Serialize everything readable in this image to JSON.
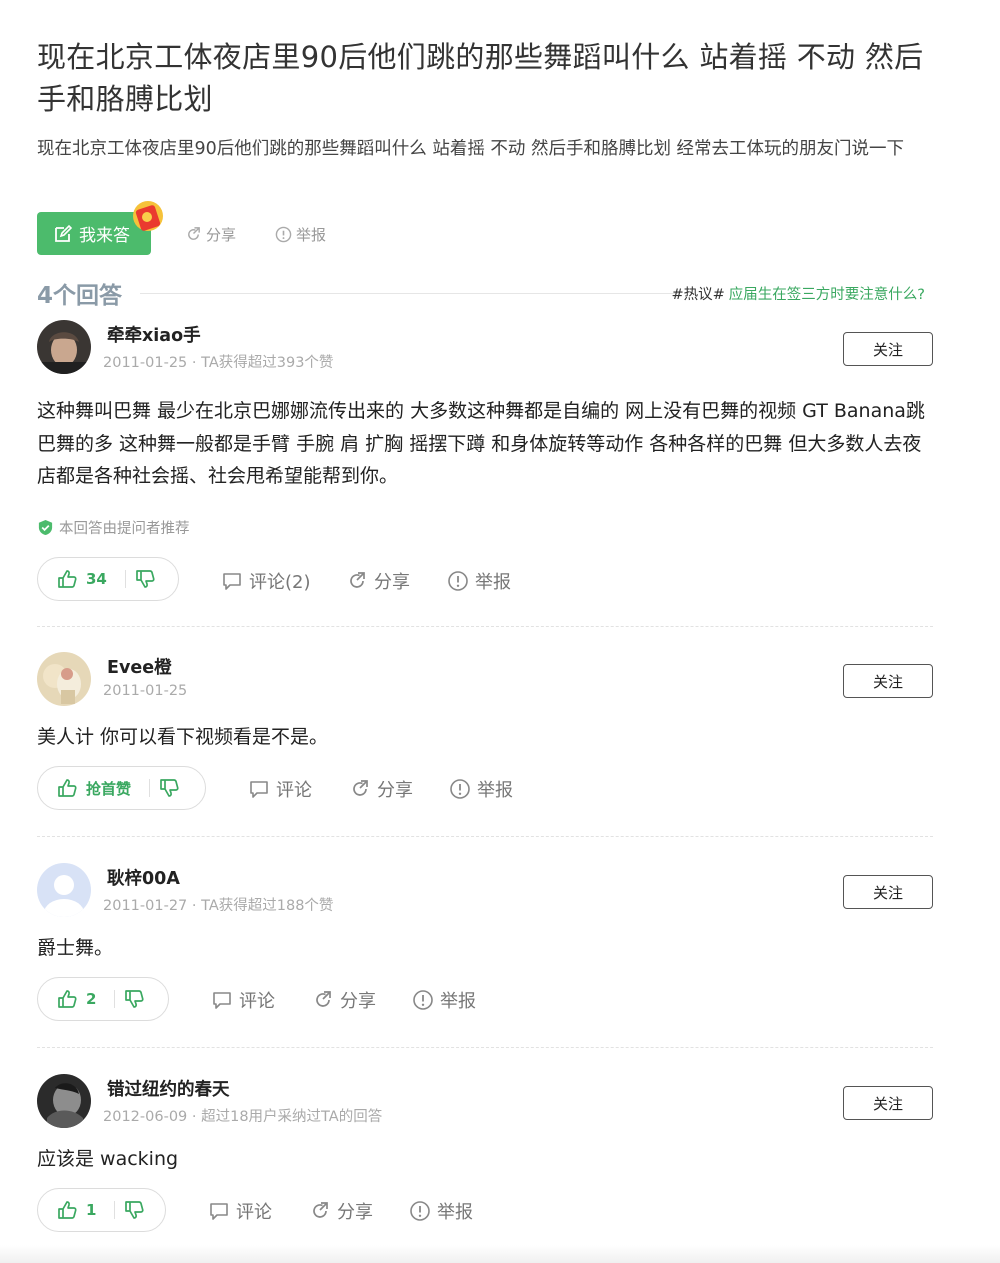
{
  "question": {
    "title": "现在北京工体夜店里90后他们跳的那些舞蹈叫什么 站着摇 不动 然后手和胳膊比划",
    "description": "现在北京工体夜店里90后他们跳的那些舞蹈叫什么 站着摇 不动 然后手和胳膊比划 经常去工体玩的朋友门说一下",
    "answer_button": "我来答",
    "share": "分享",
    "report": "举报"
  },
  "answers_header": {
    "count": "4个回答",
    "hot_prefix": "#热议#",
    "hot_link": "应届生在签三方时要注意什么?"
  },
  "labels": {
    "follow": "关注",
    "share": "分享",
    "report": "举报",
    "recommended": "本回答由提问者推荐"
  },
  "answers": [
    {
      "author": "牵牵xiao手",
      "meta": "2011-01-25 · TA获得超过393个赞",
      "content": "这种舞叫巴舞 最少在北京巴娜娜流传出来的 大多数这种舞都是自编的 网上没有巴舞的视频 GT Banana跳巴舞的多 这种舞一般都是手臂 手腕 肩 扩胸 摇摆下蹲 和身体旋转等动作 各种各样的巴舞 但大多数人去夜店都是各种社会摇、社会甩希望能帮到你。",
      "likes": "34",
      "comment": "评论(2)"
    },
    {
      "author": "Evee橙",
      "meta": "2011-01-25",
      "content": "美人计 你可以看下视频看是不是。",
      "likes": "抢首赞",
      "comment": "评论"
    },
    {
      "author": "耿梓00A",
      "meta": "2011-01-27 · TA获得超过188个赞",
      "content": "爵士舞。",
      "likes": "2",
      "comment": "评论"
    },
    {
      "author": "错过纽约的春天",
      "meta": "2012-06-09 · 超过18用户采纳过TA的回答",
      "content": "应该是 wacking",
      "likes": "1",
      "comment": "评论"
    }
  ],
  "colors": {
    "brand_green": "#4cbb6c",
    "link_green": "#3aa860",
    "muted": "#999999"
  }
}
